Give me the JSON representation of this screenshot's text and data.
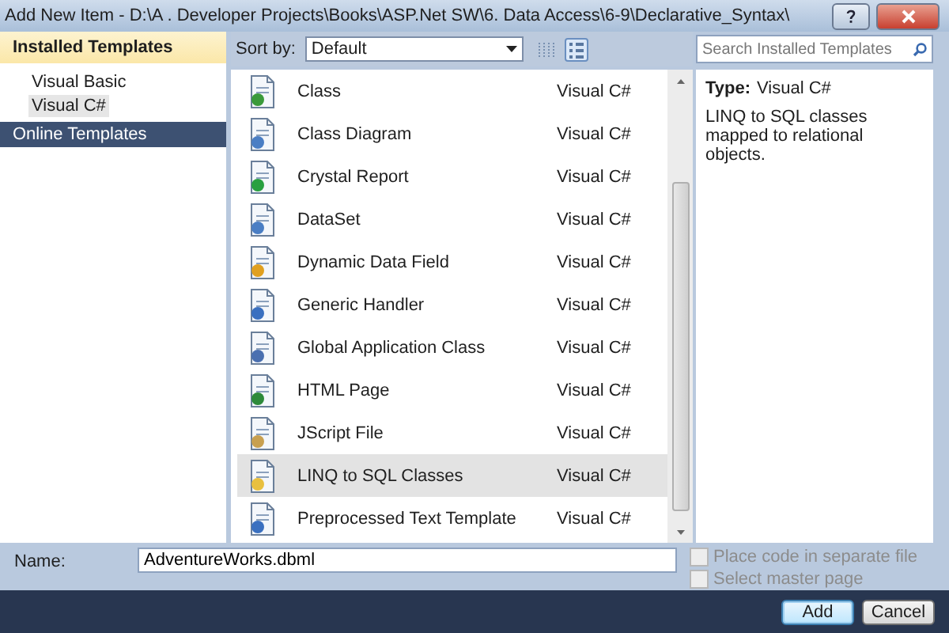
{
  "window": {
    "title": "Add New Item - D:\\A . Developer Projects\\Books\\ASP.Net SW\\6. Data Access\\6-9\\Declarative_Syntax\\"
  },
  "sidebar": {
    "header": "Installed Templates",
    "items": [
      {
        "label": "Visual Basic",
        "selected": false
      },
      {
        "label": "Visual C#",
        "selected": true
      }
    ],
    "online": "Online Templates"
  },
  "toolbar": {
    "sort_label": "Sort by:",
    "sort_value": "Default",
    "view_buttons": [
      {
        "selected": false
      },
      {
        "selected": true
      }
    ],
    "search": {
      "placeholder": "Search Installed Templates"
    }
  },
  "templates": [
    {
      "name": "Class",
      "language": "Visual C#",
      "selected": false
    },
    {
      "name": "Class Diagram",
      "language": "Visual C#",
      "selected": false
    },
    {
      "name": "Crystal Report",
      "language": "Visual C#",
      "selected": false
    },
    {
      "name": "DataSet",
      "language": "Visual C#",
      "selected": false
    },
    {
      "name": "Dynamic Data Field",
      "language": "Visual C#",
      "selected": false
    },
    {
      "name": "Generic Handler",
      "language": "Visual C#",
      "selected": false
    },
    {
      "name": "Global Application Class",
      "language": "Visual C#",
      "selected": false
    },
    {
      "name": "HTML Page",
      "language": "Visual C#",
      "selected": false
    },
    {
      "name": "JScript File",
      "language": "Visual C#",
      "selected": false
    },
    {
      "name": "LINQ to SQL Classes",
      "language": "Visual C#",
      "selected": true
    },
    {
      "name": "Preprocessed Text Template",
      "language": "Visual C#",
      "selected": false
    }
  ],
  "details": {
    "type_label": "Type:",
    "type_value": "Visual C#",
    "description": "LINQ to SQL classes mapped to relational objects."
  },
  "name_field": {
    "label": "Name:",
    "value": "AdventureWorks.dbml"
  },
  "options": [
    {
      "label": "Place code in separate file",
      "checked": false,
      "disabled": true
    },
    {
      "label": "Select master page",
      "checked": false,
      "disabled": true
    }
  ],
  "buttons": [
    {
      "label": "Add",
      "default": true
    },
    {
      "label": "Cancel",
      "default": false
    }
  ]
}
